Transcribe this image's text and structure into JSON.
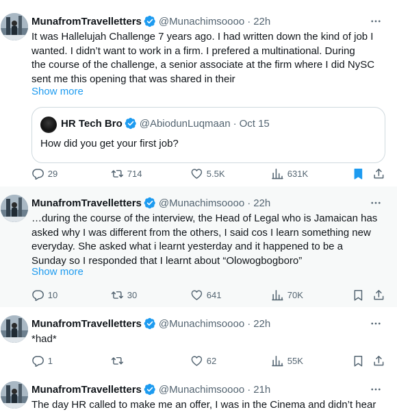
{
  "colors": {
    "accent": "#1d9bf0",
    "muted": "#536471",
    "text": "#0f1419",
    "border": "#cfd9de",
    "highlight_bg": "#f7f9f9"
  },
  "posts": [
    {
      "name": "MunafromTravelletters",
      "handle": "@Munachimsoooo",
      "time": "22h",
      "lines": [
        "It was Hallelujah Challenge 7 years ago. I had written down the kind of job I",
        "wanted. I didn’t want to work in a firm. I  prefered a multinational.  During",
        "the course of the challenge, a senior associate at the firm where I did NySC",
        "sent me this opening that was shared in their"
      ],
      "show_more": "Show more",
      "quote": {
        "name": "HR Tech Bro",
        "handle": "@AbiodunLuqmaan",
        "time": "Oct 15",
        "text": "How did you get your first job?"
      },
      "replies": "29",
      "reposts": "714",
      "likes": "5.5K",
      "views": "631K",
      "bookmarked": true
    },
    {
      "name": "MunafromTravelletters",
      "handle": "@Munachimsoooo",
      "time": "22h",
      "lines": [
        "…during the course of the interview, the Head of Legal who is Jamaican has",
        "asked why I was different from the others, I said cos I learn something new",
        "everyday. She asked what i learnt yesterday and it happened to be a",
        "Sunday so I responded that I learnt about “Olowogbogboro”"
      ],
      "show_more": "Show more",
      "replies": "10",
      "reposts": "30",
      "likes": "641",
      "views": "70K",
      "bookmarked": false
    },
    {
      "name": "MunafromTravelletters",
      "handle": "@Munachimsoooo",
      "time": "22h",
      "lines": [
        "*had*"
      ],
      "replies": "1",
      "reposts": "",
      "likes": "62",
      "views": "55K",
      "bookmarked": false
    },
    {
      "name": "MunafromTravelletters",
      "handle": "@Munachimsoooo",
      "time": "21h",
      "lines": [
        "The day HR called to make me an offer, I was in the Cinema and didn’t hear"
      ]
    }
  ],
  "icons": {
    "verified": "verified-badge-icon",
    "more": "more-horizontal-icon",
    "reply": "reply-icon",
    "repost": "repost-icon",
    "like": "heart-icon",
    "views": "views-chart-icon",
    "bookmark": "bookmark-icon",
    "share": "share-icon"
  }
}
